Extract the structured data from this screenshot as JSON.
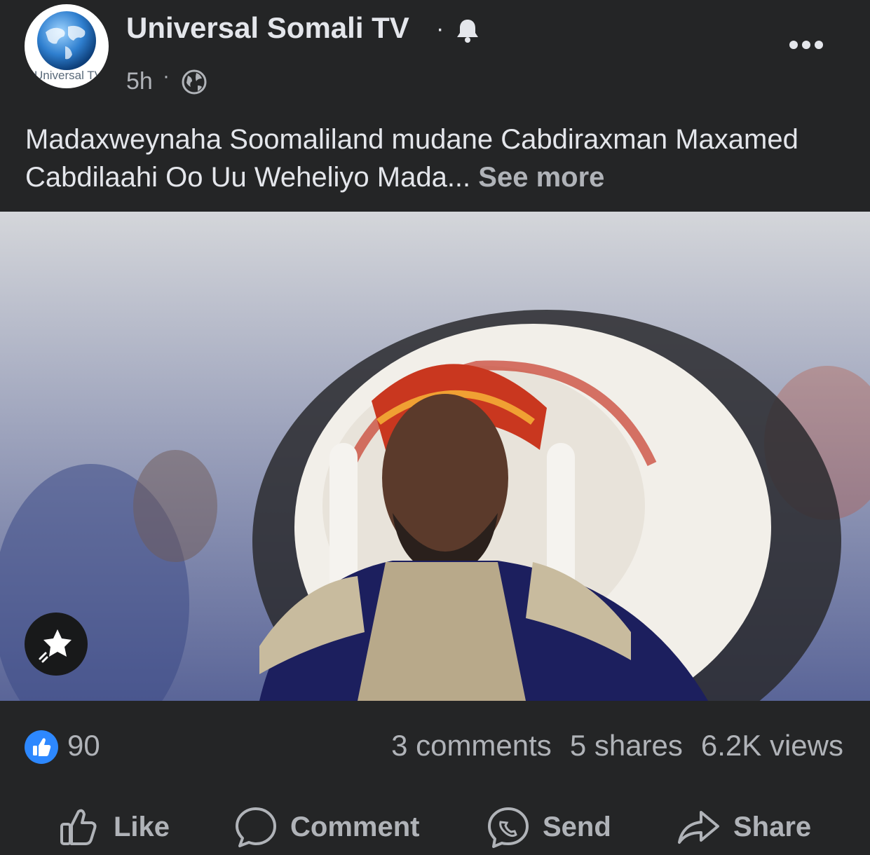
{
  "post": {
    "page_name": "Universal Somali TV",
    "name_separator": "·",
    "time": "5h",
    "time_separator": "·",
    "avatar_logo_text": "Universal TV",
    "caption": "Madaxweynaha Soomaliland mudane Cabdiraxman Maxamed Cabdilaahi Oo Uu Weheliyo  Mada...",
    "see_more": "See more"
  },
  "icons": {
    "notifications": "bell-icon",
    "audience": "globe-icon",
    "more": "more-dots-icon",
    "reels": "sparkle-star-icon",
    "reaction": "thumbs-up-icon"
  },
  "stats": {
    "like_count": "90",
    "comments": "3 comments",
    "shares": "5 shares",
    "views": "6.2K views"
  },
  "actions": {
    "like": "Like",
    "comment": "Comment",
    "send": "Send",
    "share": "Share"
  },
  "colors": {
    "background": "#242526",
    "text_primary": "#e4e6eb",
    "text_secondary": "#b0b3b8",
    "like_blue": "#2d88ff"
  }
}
